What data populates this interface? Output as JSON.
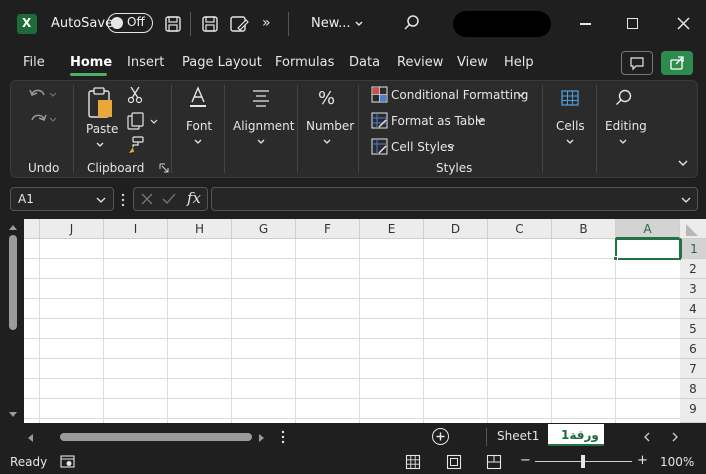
{
  "title_bar": {
    "autosave_label": "AutoSave",
    "autosave_state": "Off",
    "file_name": "New...",
    "excel_logo_letter": "X"
  },
  "menu": {
    "tabs": [
      "File",
      "Home",
      "Insert",
      "Page Layout",
      "Formulas",
      "Data",
      "Review",
      "View",
      "Help"
    ],
    "active_tab": "Home"
  },
  "ribbon": {
    "undo_group_label": "Undo",
    "clipboard_group_label": "Clipboard",
    "paste_label": "Paste",
    "font_label": "Font",
    "alignment_label": "Alignment",
    "number_label": "Number",
    "number_symbol": "%",
    "conditional_formatting_label": "Conditional Formatting",
    "format_as_table_label": "Format as Table",
    "cell_styles_label": "Cell Styles",
    "styles_group_label": "Styles",
    "cells_label": "Cells",
    "editing_label": "Editing"
  },
  "formula_bar": {
    "name_box_value": "A1",
    "fx_label": "fx",
    "formula_value": ""
  },
  "grid": {
    "columns": [
      "J",
      "I",
      "H",
      "G",
      "F",
      "E",
      "D",
      "C",
      "B",
      "A"
    ],
    "rows": [
      "1",
      "2",
      "3",
      "4",
      "5",
      "6",
      "7",
      "8",
      "9"
    ],
    "selected_column": "A",
    "selected_row": "1"
  },
  "sheets": {
    "tabs": [
      "Sheet1",
      "ورقة1"
    ],
    "active_sheet": "ورقة1"
  },
  "status_bar": {
    "status": "Ready",
    "zoom": "100%",
    "minus": "−",
    "plus": "+"
  },
  "colors": {
    "accent_green": "#217346",
    "active_sheet_text": "#1d6b38",
    "share_button": "#2e8b4e"
  }
}
